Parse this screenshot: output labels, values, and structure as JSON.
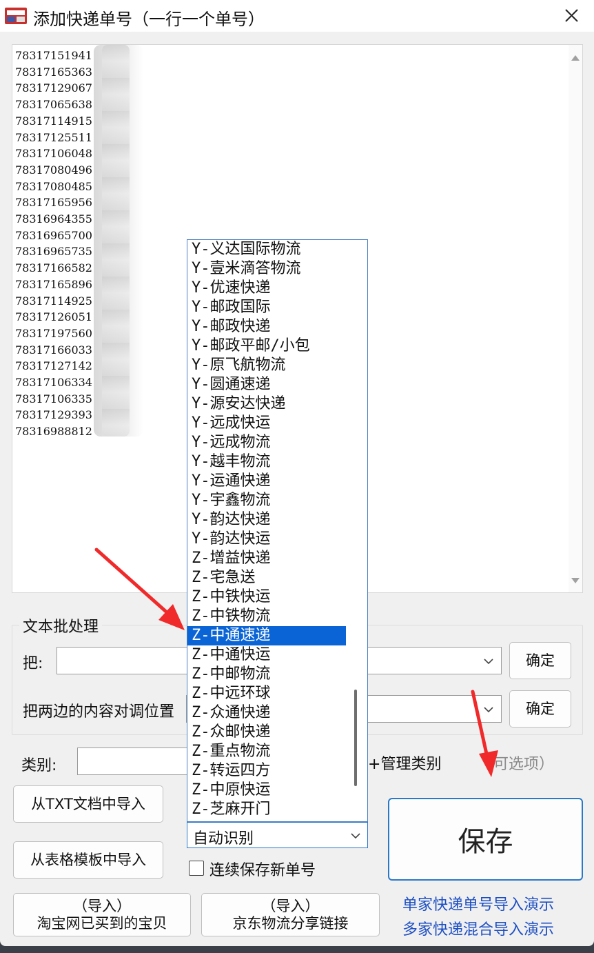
{
  "window": {
    "title": "添加快递单号（一行一个单号）"
  },
  "tracking_numbers": [
    "78317151941",
    "78317165363",
    "78317129067",
    "78317065638",
    "78317114915",
    "78317125511",
    "78317106048",
    "78317080496",
    "78317080485",
    "78317165956",
    "78316964355",
    "78316965700",
    "78316965735",
    "78317166582",
    "78317165896",
    "78317114925",
    "78317126051",
    "78317197560",
    "78317166033",
    "78317127142",
    "78317106334",
    "78317106335",
    "78317129393",
    "78316988812"
  ],
  "batch": {
    "group_title": "文本批处理",
    "replace_label": "把:",
    "swap_label": "把两边的内容对调位置",
    "confirm_label": "确定"
  },
  "category": {
    "label": "类别:",
    "manage_label": "管理类别",
    "optional_hint": "可选项）"
  },
  "carrier_combo": {
    "selected": "自动识别",
    "options": [
      "Y-义达国际物流",
      "Y-壹米滴答物流",
      "Y-优速快递",
      "Y-邮政国际",
      "Y-邮政快递",
      "Y-邮政平邮/小包",
      "Y-原飞航物流",
      "Y-圆通速递",
      "Y-源安达快递",
      "Y-远成快运",
      "Y-远成物流",
      "Y-越丰物流",
      "Y-运通快递",
      "Y-宇鑫物流",
      "Y-韵达快递",
      "Y-韵达快运",
      "Z-增益快递",
      "Z-宅急送",
      "Z-中铁快运",
      "Z-中铁物流",
      "Z-中通速递",
      "Z-中通快运",
      "Z-中邮物流",
      "Z-中远环球",
      "Z-众通快递",
      "Z-众邮快递",
      "Z-重点物流",
      "Z-转运四方",
      "Z-中原快运",
      "Z-芝麻开门"
    ],
    "highlighted_index": 20
  },
  "buttons": {
    "import_txt": "从TXT文档中导入",
    "import_table": "从表格模板中导入",
    "import_taobao_line1": "（导入）",
    "import_taobao_line2": "淘宝网已买到的宝贝",
    "import_jd_line1": "（导入）",
    "import_jd_line2": "京东物流分享链接",
    "save": "保存"
  },
  "checkbox": {
    "label": "连续保存新单号",
    "checked": false
  },
  "links": {
    "single_demo": "单家快递单号导入演示",
    "multi_demo": "多家快递混合导入演示"
  },
  "colors": {
    "selection": "#0a64d6",
    "link": "#1d4fc4",
    "annotation_arrow": "#f02a2a",
    "save_border": "#2a79c9"
  }
}
